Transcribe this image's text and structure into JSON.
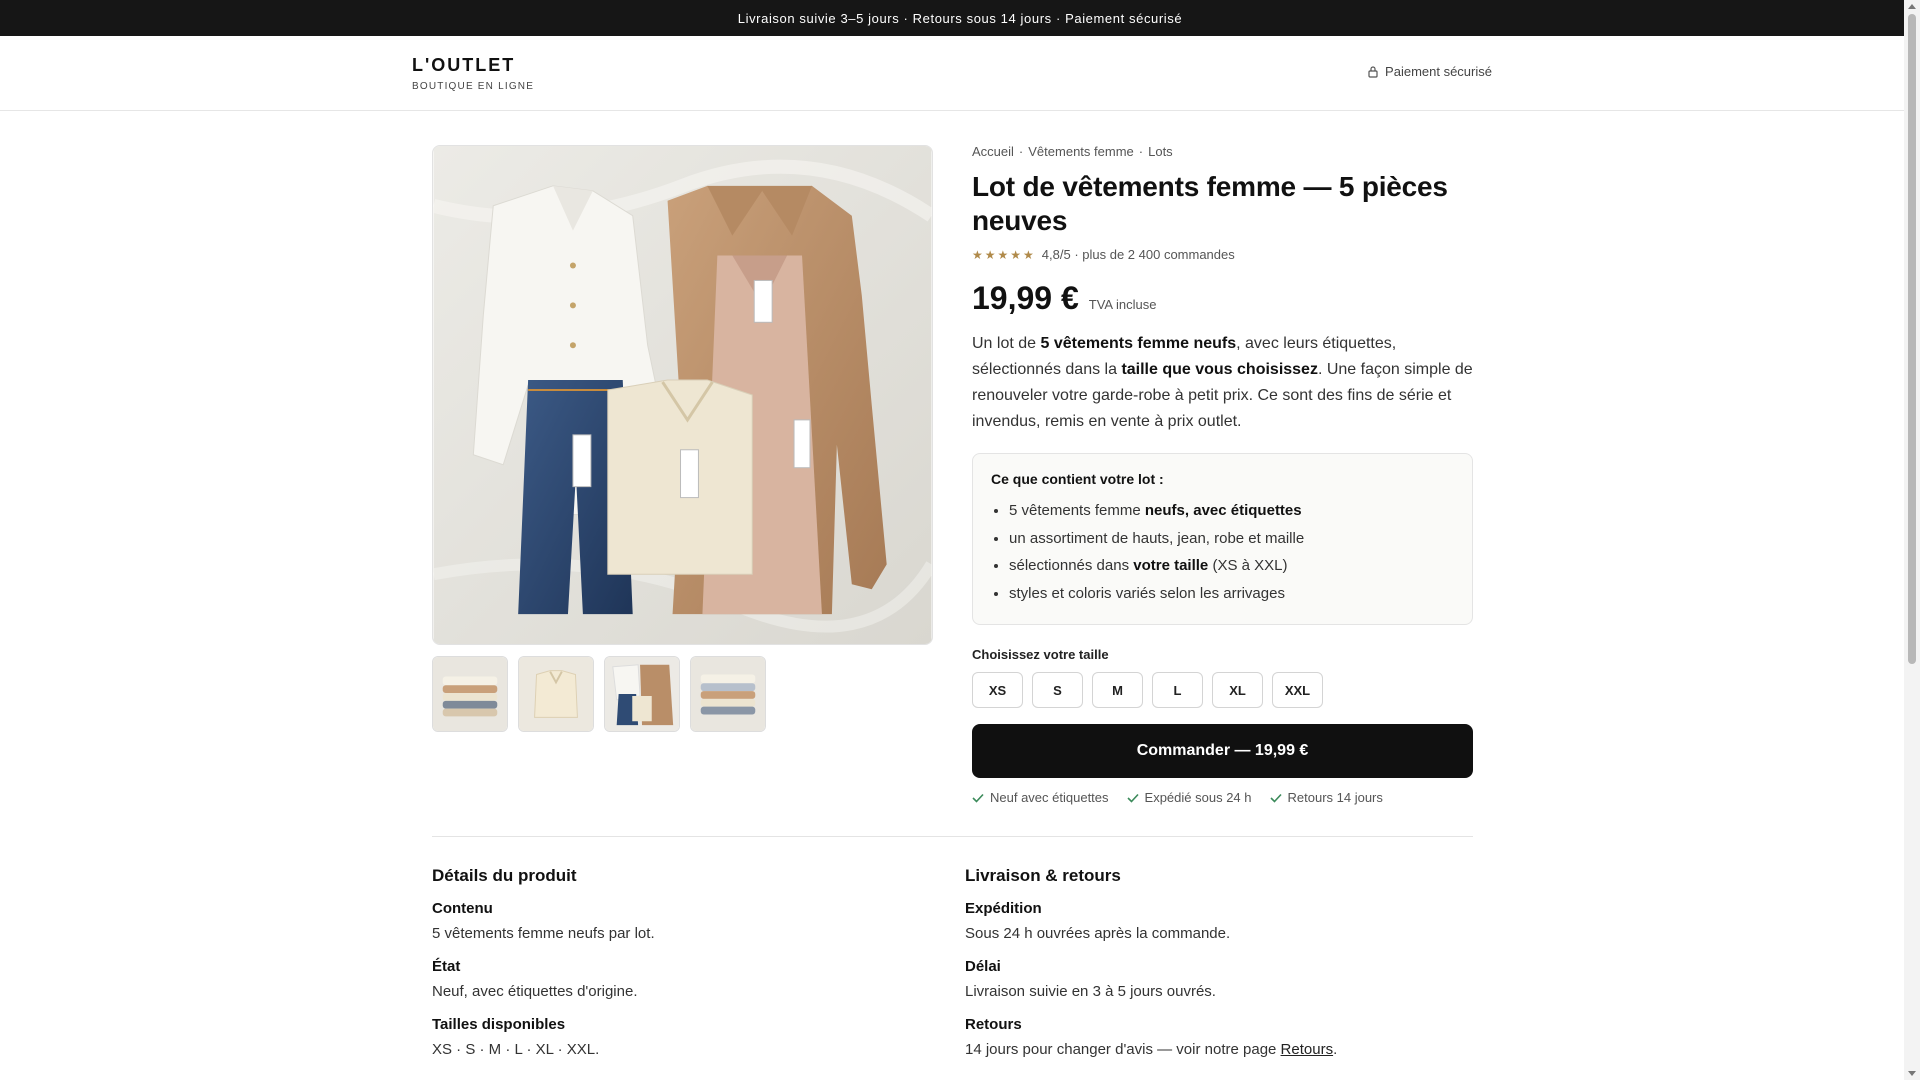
{
  "announcement": "Livraison suivie 3–5 jours · Retours sous 14 jours · Paiement sécurisé",
  "header": {
    "brand": "L'OUTLET",
    "tagline": "BOUTIQUE EN LIGNE",
    "secure": "Paiement sécurisé"
  },
  "breadcrumb": [
    "Accueil",
    "·",
    "Vêtements femme",
    "·",
    "Lots"
  ],
  "product": {
    "title": "Lot de vêtements femme — 5 pièces neuves",
    "stars": "★★★★★",
    "rating": "4,8/5 · plus de 2 400 commandes",
    "price": "19,99 €",
    "vat": "TVA incluse",
    "desc": [
      "Un lot de ",
      "5 vêtements femme neufs",
      ", avec leurs étiquettes, sélectionnés dans la ",
      "taille que vous choisissez",
      ". Une façon simple de renouveler votre garde-robe à petit prix. Ce sont des fins de série et invendus, remis en vente à prix outlet."
    ]
  },
  "contents": {
    "title": "Ce que contient votre lot :",
    "items": [
      [
        "5 vêtements femme ",
        "neufs, avec étiquettes",
        ""
      ],
      [
        "un assortiment de hauts, jean, robe et maille",
        "",
        ""
      ],
      [
        "sélectionnés dans ",
        "votre taille",
        " (XS à XXL)"
      ],
      [
        "styles et coloris variés selon les arrivages",
        "",
        ""
      ]
    ]
  },
  "sizes": {
    "label": "Choisissez votre taille",
    "options": [
      "XS",
      "S",
      "M",
      "L",
      "XL",
      "XXL"
    ]
  },
  "order_button": "Commander — 19,99 €",
  "assurances": [
    "Neuf avec étiquettes",
    "Expédié sous 24 h",
    "Retours 14 jours"
  ],
  "details": {
    "title": "Détails du produit",
    "items": [
      {
        "label": "Contenu",
        "value": "5 vêtements femme neufs par lot."
      },
      {
        "label": "État",
        "value": "Neuf, avec étiquettes d'origine."
      },
      {
        "label": "Tailles disponibles",
        "value": "XS · S · M · L · XL · XXL."
      }
    ]
  },
  "shipping": {
    "title": "Livraison & retours",
    "items": [
      {
        "label": "Expédition",
        "value": "Sous 24 h ouvrées après la commande."
      },
      {
        "label": "Délai",
        "value": "Livraison suivie en 3 à 5 jours ouvrés."
      },
      {
        "label": "Retours",
        "value": "14 jours pour changer d'avis — voir notre page ",
        "link": "Retours",
        "tail": "."
      }
    ]
  },
  "colors": {
    "announce_bg": "#161616",
    "button_bg": "#101010",
    "star": "#b08a4a",
    "check": "#3b8a5a"
  }
}
